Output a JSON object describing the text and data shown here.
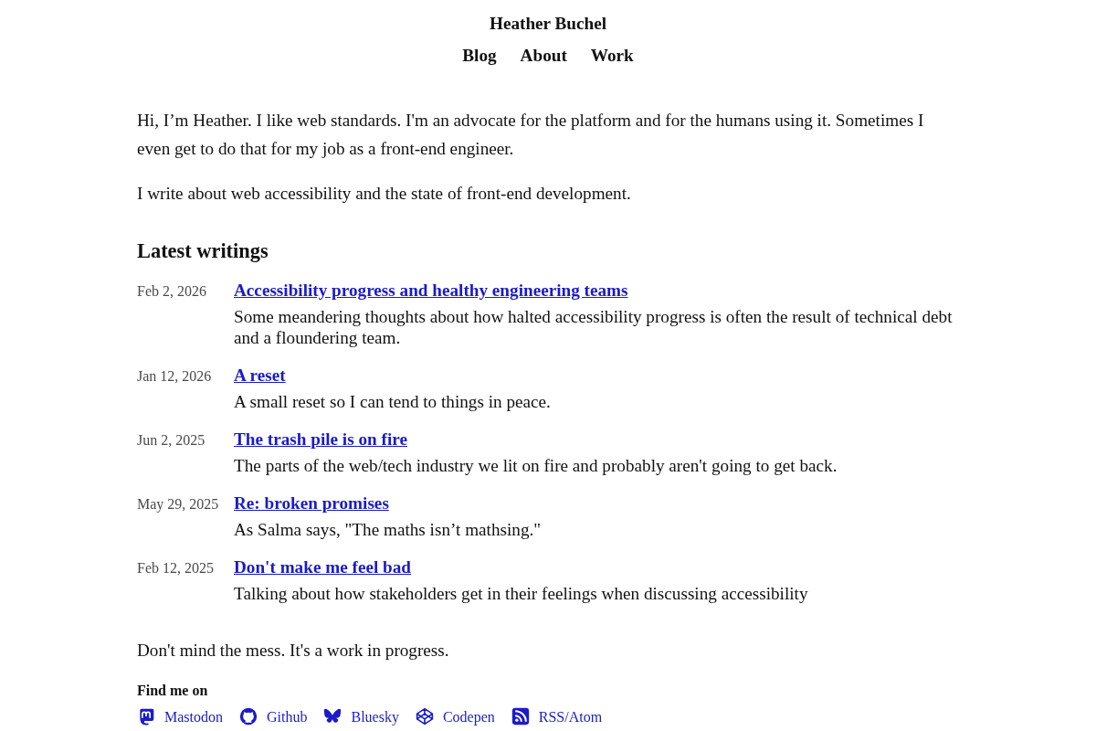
{
  "site": {
    "title": "Heather Buchel",
    "nav": [
      "Blog",
      "About",
      "Work"
    ]
  },
  "intro": [
    "Hi, I’m Heather. I like web standards. I'm an advocate for the platform and for the humans using it. Sometimes I even get to do that for my job as a front-end engineer.",
    "I write about web accessibility and the state of front-end development."
  ],
  "writings": {
    "heading": "Latest writings",
    "posts": [
      {
        "date": "Feb 2, 2026",
        "title": "Accessibility progress and healthy engineering teams",
        "summary": "Some meandering thoughts about how halted accessibility progress is often the result of technical debt and a floundering team."
      },
      {
        "date": "Jan 12, 2026",
        "title": "A reset",
        "summary": "A small reset so I can tend to things in peace."
      },
      {
        "date": "Jun 2, 2025",
        "title": "The trash pile is on fire",
        "summary": "The parts of the web/tech industry we lit on fire and probably aren't going to get back."
      },
      {
        "date": "May 29, 2025",
        "title": "Re: broken promises",
        "summary": "As Salma says, \"The maths isn’t mathsing.\""
      },
      {
        "date": "Feb 12, 2025",
        "title": "Don't make me feel bad",
        "summary": "Talking about how stakeholders get in their feelings when discussing accessibility"
      }
    ]
  },
  "note": "Don't mind the mess. It's a work in progress.",
  "find_me": {
    "heading": "Find me on",
    "links": [
      {
        "kind": "mastodon",
        "label": "Mastodon"
      },
      {
        "kind": "github",
        "label": "Github"
      },
      {
        "kind": "bluesky",
        "label": "Bluesky"
      },
      {
        "kind": "codepen",
        "label": "Codepen"
      },
      {
        "kind": "rss",
        "label": "RSS/Atom"
      }
    ]
  }
}
